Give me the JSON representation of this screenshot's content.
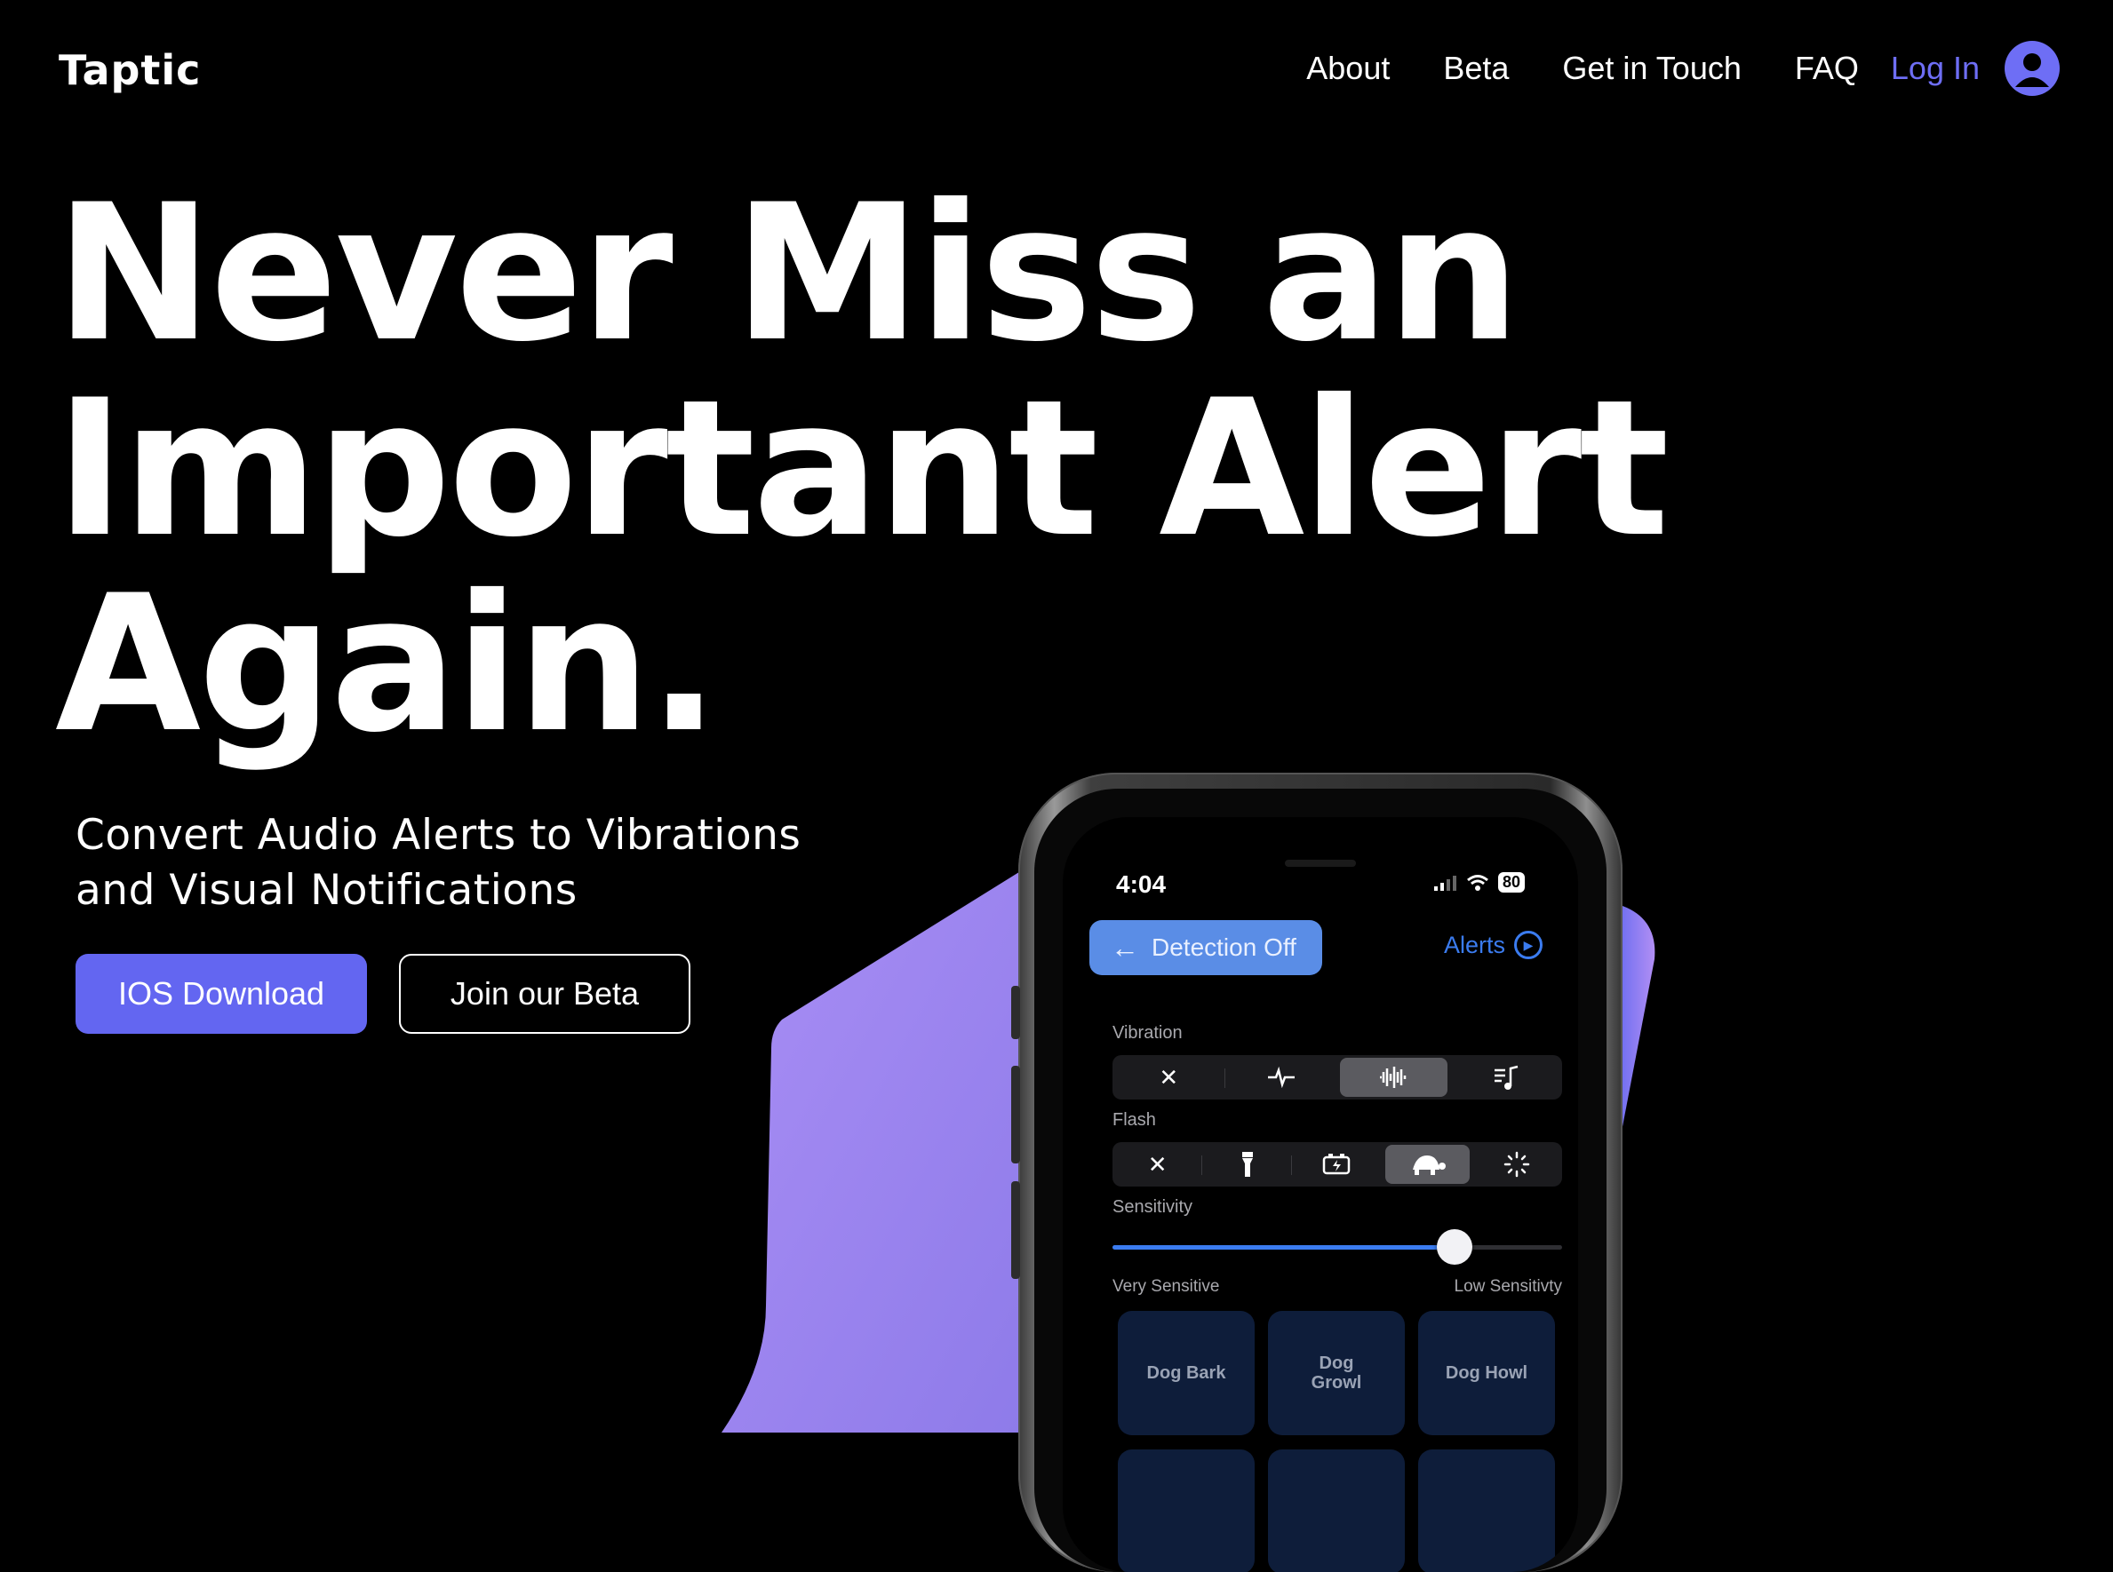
{
  "brand": {
    "name": "Taptic"
  },
  "nav": {
    "items": [
      {
        "label": "About"
      },
      {
        "label": "Beta"
      },
      {
        "label": "Get in Touch"
      },
      {
        "label": "FAQ"
      }
    ],
    "login_label": "Log In",
    "avatar_icon": "user-avatar-icon"
  },
  "hero": {
    "headline_lines": [
      "Never Miss an",
      "Important Alert",
      "Again."
    ],
    "subtitle_lines": [
      "Convert Audio Alerts to Vibrations",
      "and Visual Notifications"
    ],
    "primary_button": "IOS Download",
    "secondary_button": "Join our Beta"
  },
  "phone": {
    "status": {
      "time": "4:04",
      "battery": "80"
    },
    "detect_button": "Detection Off",
    "alerts_label": "Alerts",
    "vibration": {
      "label": "Vibration",
      "options": [
        "close-icon",
        "pulse-icon",
        "waveform-icon",
        "music-note-icon"
      ],
      "selected_index": 2
    },
    "flash": {
      "label": "Flash",
      "options": [
        "close-icon",
        "flashlight-icon",
        "battery-charging-icon",
        "turtle-icon",
        "spinner-icon"
      ],
      "selected_index": 3
    },
    "sensitivity": {
      "label": "Sensitivity",
      "value": 0.76,
      "min_label": "Very Sensitive",
      "max_label": "Low Sensitivty"
    },
    "sounds": [
      "Dog Bark",
      "Dog Growl",
      "Dog Howl",
      "",
      "",
      ""
    ]
  },
  "colors": {
    "accent": "#6366f1",
    "login": "#6e6ef5",
    "blob": "#9b83ee",
    "ios_blue": "#3b7cf0",
    "tile": "#0e1d3a"
  }
}
